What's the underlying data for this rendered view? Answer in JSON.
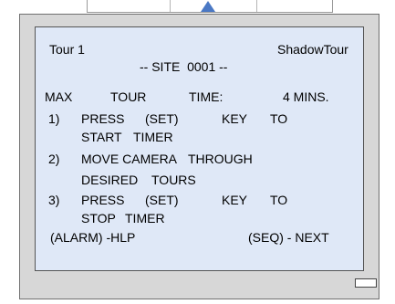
{
  "header": {
    "tour_name": "Tour 1",
    "tour_type": "ShadowTour",
    "site": "-- SITE  0001 --"
  },
  "max_time": {
    "label_max": "MAX",
    "label_tour": "TOUR",
    "label_time": "TIME:",
    "value": "4 MINS."
  },
  "steps": [
    {
      "number": "1)",
      "line1": [
        "PRESS",
        "(SET)",
        "KEY",
        "TO"
      ],
      "line2": [
        "START",
        "TIMER"
      ]
    },
    {
      "number": "2)",
      "line1": [
        "MOVE CAMERA",
        "THROUGH"
      ],
      "line2": [
        "DESIRED",
        "TOURS"
      ]
    },
    {
      "number": "3)",
      "line1": [
        "PRESS",
        "(SET)",
        "KEY",
        "TO"
      ],
      "line2": [
        "STOP",
        "TIMER"
      ]
    }
  ],
  "footer": {
    "help": "(ALARM) -HLP",
    "next": "(SEQ) - NEXT"
  },
  "colors": {
    "screen_background": "#dfe8f7",
    "bezel": "#d7d7d7",
    "arrow": "#4a78c4"
  },
  "icons": {
    "top_arrow": "up-arrow-icon",
    "indicator": "status-indicator"
  }
}
